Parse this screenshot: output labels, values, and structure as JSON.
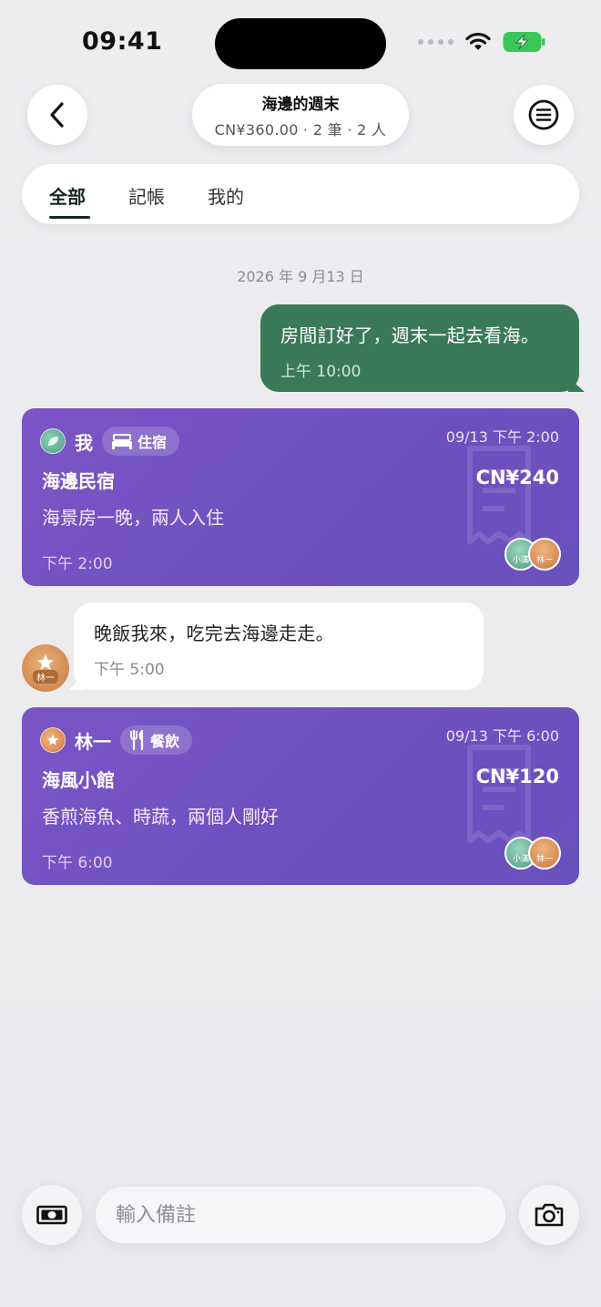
{
  "status_bar": {
    "time": "09:41"
  },
  "header": {
    "title": "海邊的週末",
    "subtitle": "CN¥360.00 · 2 筆 · 2 人",
    "back_icon": "chevron-left-icon",
    "menu_icon": "list-menu-icon"
  },
  "tabs": [
    {
      "label": "全部",
      "active": true
    },
    {
      "label": "記帳",
      "active": false
    },
    {
      "label": "我的",
      "active": false
    }
  ],
  "date_separator": "2026 年 9 月13 日",
  "messages": [
    {
      "type": "outgoing",
      "text": "房間訂好了，週末一起去看海。",
      "time": "上午 10:00"
    },
    {
      "type": "incoming",
      "text": "晚飯我來，吃完去海邊走走。",
      "time": "下午 5:00"
    }
  ],
  "expenses": [
    {
      "payer": "我",
      "category": "住宿",
      "category_icon": "bed-icon",
      "date": "09/13 下午 2:00",
      "name": "海邊民宿",
      "amount": "CN¥240",
      "note": "海景房一晚，兩人入住",
      "time": "下午 2:00",
      "participants": [
        "小滿",
        "林一"
      ]
    },
    {
      "payer": "林一",
      "category": "餐飲",
      "category_icon": "fork-knife-icon",
      "date": "09/13 下午 6:00",
      "name": "海風小館",
      "amount": "CN¥120",
      "note": "香煎海魚、時蔬，兩個人剛好",
      "time": "下午 6:00",
      "participants": [
        "小滿",
        "林一"
      ]
    }
  ],
  "incoming_avatar_label": "林一",
  "composer": {
    "placeholder": "輸入備註"
  },
  "colors": {
    "accent_green": "#3a7a58",
    "card_purple": "#6f50c0",
    "tab_active": "#16291f"
  }
}
